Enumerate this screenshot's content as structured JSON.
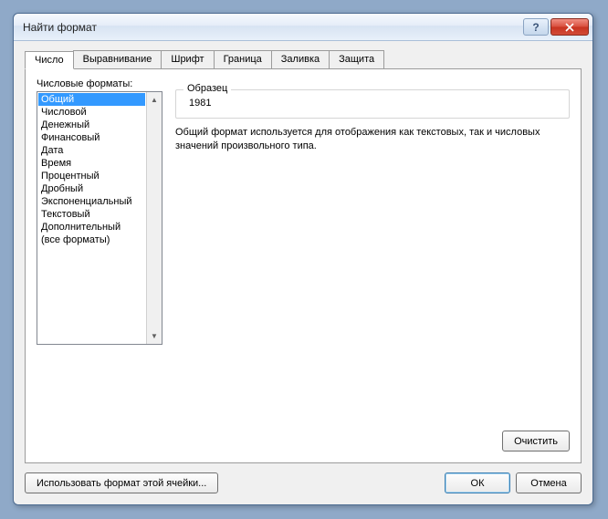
{
  "title": "Найти формат",
  "tabs": [
    "Число",
    "Выравнивание",
    "Шрифт",
    "Граница",
    "Заливка",
    "Защита"
  ],
  "active_tab": 0,
  "formats_label": "Числовые форматы:",
  "formats": [
    "Общий",
    "Числовой",
    "Денежный",
    "Финансовый",
    "Дата",
    "Время",
    "Процентный",
    "Дробный",
    "Экспоненциальный",
    "Текстовый",
    "Дополнительный",
    "(все форматы)"
  ],
  "selected_format": 0,
  "sample": {
    "legend": "Образец",
    "value": "1981"
  },
  "description": "Общий формат используется для отображения как текстовых, так и числовых значений произвольного типа.",
  "buttons": {
    "clear": "Очистить",
    "use_cell_format": "Использовать формат этой ячейки...",
    "ok": "ОК",
    "cancel": "Отмена"
  }
}
